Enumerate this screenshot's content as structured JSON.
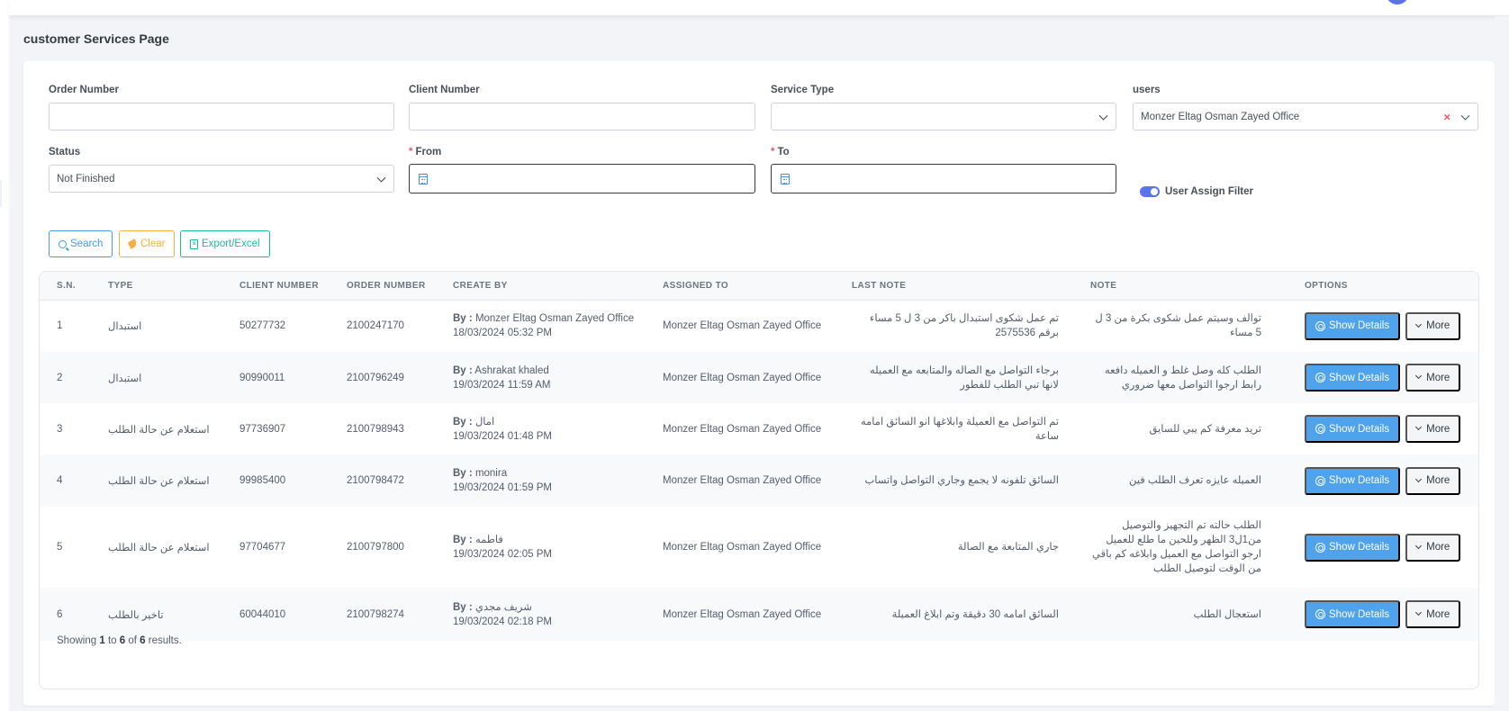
{
  "page": {
    "title": "customer Services Page"
  },
  "filters": {
    "order_number": {
      "label": "Order Number",
      "value": "",
      "placeholder": ""
    },
    "client_number": {
      "label": "Client Number",
      "value": "",
      "placeholder": ""
    },
    "service_type": {
      "label": "Service Type",
      "value": ""
    },
    "users": {
      "label": "users",
      "value": "Monzer Eltag Osman Zayed Office",
      "clear_icon": "×"
    },
    "status": {
      "label": "Status",
      "value": "Not Finished"
    },
    "from": {
      "label": "From",
      "required_mark": "*",
      "value": ""
    },
    "to": {
      "label": "To",
      "required_mark": "*",
      "value": ""
    },
    "user_assign_filter": {
      "label": "User Assign Filter",
      "enabled": true
    }
  },
  "actions": {
    "search": "Search",
    "clear": "Clear",
    "export": "Export/Excel",
    "excel_glyph": "x"
  },
  "table": {
    "columns": [
      "S.N.",
      "TYPE",
      "CLIENT NUMBER",
      "ORDER NUMBER",
      "CREATE BY",
      "ASSIGNED TO",
      "LAST NOTE",
      "NOTE",
      "OPTIONS"
    ],
    "by_prefix": "By :",
    "show_details_label": "Show Details",
    "more_label": "More",
    "rows": [
      {
        "sn": "1",
        "type": "استبدال",
        "client_number": "50277732",
        "order_number": "2100247170",
        "created_by": "Monzer Eltag Osman Zayed Office",
        "created_at": "18/03/2024 05:32 PM",
        "assigned_to": "Monzer Eltag Osman Zayed Office",
        "last_note": "تم عمل شكوى استبدال باكر من 3 ل 5 مساء برقم 2575536",
        "note": "توالف وسيتم عمل شكوى بكرة من 3 ل 5 مساء"
      },
      {
        "sn": "2",
        "type": "استبدال",
        "client_number": "90990011",
        "order_number": "2100796249",
        "created_by": "Ashrakat khaled",
        "created_at": "19/03/2024 11:59 AM",
        "assigned_to": "Monzer Eltag Osman Zayed Office",
        "last_note": "برجاء التواصل مع الصاله والمتابعه مع العميله لانها تبي الطلب للفطور",
        "note": "الطلب كله وصل غلط و العميله دافعه رابط ارجوا التواصل معها ضروري"
      },
      {
        "sn": "3",
        "type": "استعلام عن حالة الطلب",
        "client_number": "97736907",
        "order_number": "2100798943",
        "created_by": "امال",
        "created_at": "19/03/2024 01:48 PM",
        "assigned_to": "Monzer Eltag Osman Zayed Office",
        "last_note": "تم التواصل مع العميلة وابلاغها انو السائق امامه ساعة",
        "note": "تريد معرفة كم يبي للسايق"
      },
      {
        "sn": "4",
        "type": "استعلام عن حالة الطلب",
        "client_number": "99985400",
        "order_number": "2100798472",
        "created_by": "monira",
        "created_at": "19/03/2024 01:59 PM",
        "assigned_to": "Monzer Eltag Osman Zayed Office",
        "last_note": "السائق تلفونه لا يجمع وجاري التواصل واتساب",
        "note": "العميله عايزه تعرف الطلب فين"
      },
      {
        "sn": "5",
        "type": "استعلام عن حالة الطلب",
        "client_number": "97704677",
        "order_number": "2100797800",
        "created_by": "فاطمه",
        "created_at": "19/03/2024 02:05 PM",
        "assigned_to": "Monzer Eltag Osman Zayed Office",
        "last_note": "جاري المتابعة مع الصالة",
        "note": "الطلب حالته تم التجهيز والتوصيل من1ل3 الظهر وللحين ما طلع للعميل ارجو التواصل مع العميل وابلاغه كم باقي من الوقت لتوصيل الطلب"
      },
      {
        "sn": "6",
        "type": "تاخير بالطلب",
        "client_number": "60044010",
        "order_number": "2100798274",
        "created_by": "شريف مجدي",
        "created_at": "19/03/2024 02:18 PM",
        "assigned_to": "Monzer Eltag Osman Zayed Office",
        "last_note": "السائق امامه 30 دقيقة وتم ابلاغ العميلة",
        "note": "استعجال الطلب"
      }
    ]
  },
  "pagination": {
    "prefix": "Showing",
    "from": "1",
    "to_word": "to",
    "to": "6",
    "of_word": "of",
    "total": "6",
    "suffix": "results."
  },
  "colors": {
    "primary": "#5b73e8",
    "info_button": "#4fa3ec",
    "search_outline": "#4a9ae8",
    "clear_outline": "#f5b041",
    "export_outline": "#1abc9c",
    "danger": "#f1556c"
  }
}
